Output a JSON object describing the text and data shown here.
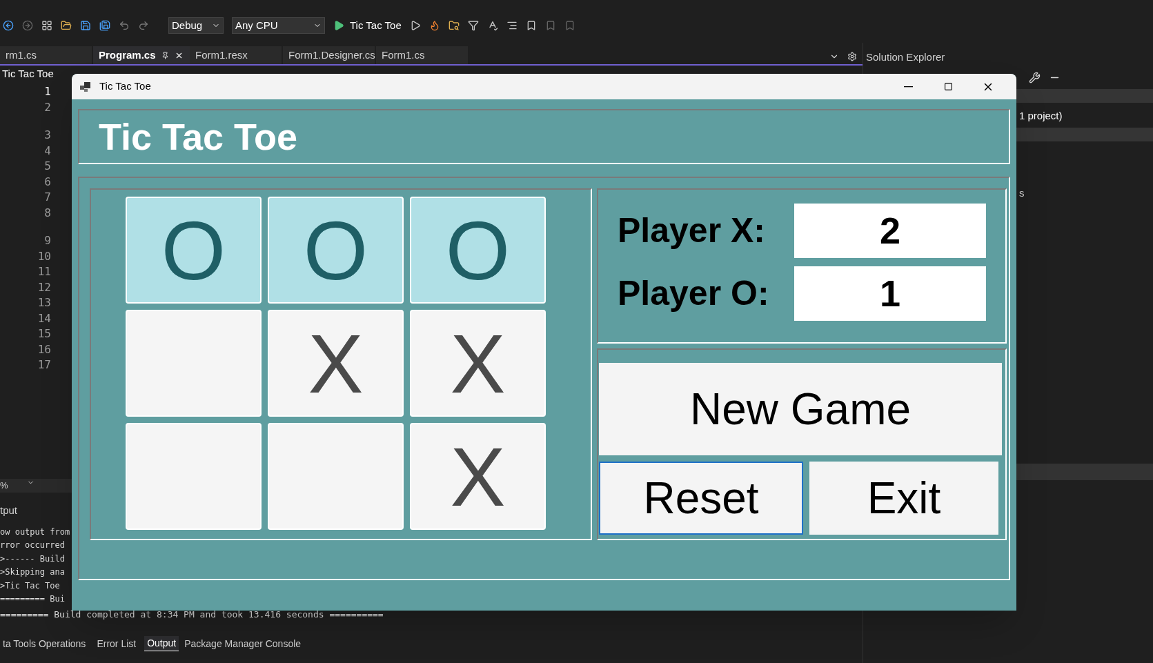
{
  "ide": {
    "toolbar": {
      "configuration": "Debug",
      "platform": "Any CPU",
      "start_label": "Tic Tac Toe"
    },
    "doc_tabs": [
      {
        "label": "rm1.cs",
        "selected": false
      },
      {
        "label": "Program.cs",
        "selected": true
      },
      {
        "label": "Form1.resx",
        "selected": false
      },
      {
        "label": "Form1.Designer.cs",
        "selected": false
      },
      {
        "label": "Form1.cs",
        "selected": false
      }
    ],
    "nav_dropdown": "Tic Tac Toe",
    "line_groups": [
      [
        {
          "number": "1",
          "current": true
        },
        {
          "number": "2",
          "current": false
        }
      ],
      [
        {
          "number": "3",
          "current": false
        },
        {
          "number": "4",
          "current": false
        },
        {
          "number": "5",
          "current": false
        },
        {
          "number": "6",
          "current": false
        },
        {
          "number": "7",
          "current": false
        },
        {
          "number": "8",
          "current": false
        }
      ],
      [
        {
          "number": "9",
          "current": false
        },
        {
          "number": "10",
          "current": false
        },
        {
          "number": "11",
          "current": false
        },
        {
          "number": "12",
          "current": false
        },
        {
          "number": "13",
          "current": false
        },
        {
          "number": "14",
          "current": false
        },
        {
          "number": "15",
          "current": false
        },
        {
          "number": "16",
          "current": false
        },
        {
          "number": "17",
          "current": false
        }
      ]
    ],
    "zoom": "%",
    "output": {
      "title": "tput",
      "lines": [
        "ow output from",
        "rror occurred",
        ">------ Build",
        ">Skipping ana",
        ">Tic Tac Toe",
        "========= Bui",
        "========= Build completed at 8:34 PM and took 13.416 seconds =========="
      ]
    },
    "bottom_tabs": [
      {
        "label": "ta Tools Operations",
        "selected": false
      },
      {
        "label": "Error List",
        "selected": false
      },
      {
        "label": "Output",
        "selected": true
      },
      {
        "label": "Package Manager Console",
        "selected": false
      }
    ],
    "solution_explorer": {
      "title": "Solution Explorer",
      "items": [
        "1 project)",
        "s"
      ]
    }
  },
  "app": {
    "title": "Tic Tac Toe",
    "heading": "Tic Tac Toe",
    "board": [
      {
        "mark": "O",
        "highlighted": true
      },
      {
        "mark": "O",
        "highlighted": true
      },
      {
        "mark": "O",
        "highlighted": true
      },
      {
        "highlighted": false
      },
      {
        "mark": "X",
        "highlighted": false
      },
      {
        "mark": "X",
        "highlighted": false
      },
      {
        "highlighted": false
      },
      {
        "highlighted": false
      },
      {
        "mark": "X",
        "highlighted": false
      }
    ],
    "scores": [
      {
        "label": "Player X:",
        "value": "2"
      },
      {
        "label": "Player O:",
        "value": "1"
      }
    ],
    "buttons": [
      {
        "label": "New Game",
        "focused": false
      },
      {
        "label": "Reset",
        "focused": true
      },
      {
        "label": "Exit",
        "focused": false
      }
    ]
  }
}
